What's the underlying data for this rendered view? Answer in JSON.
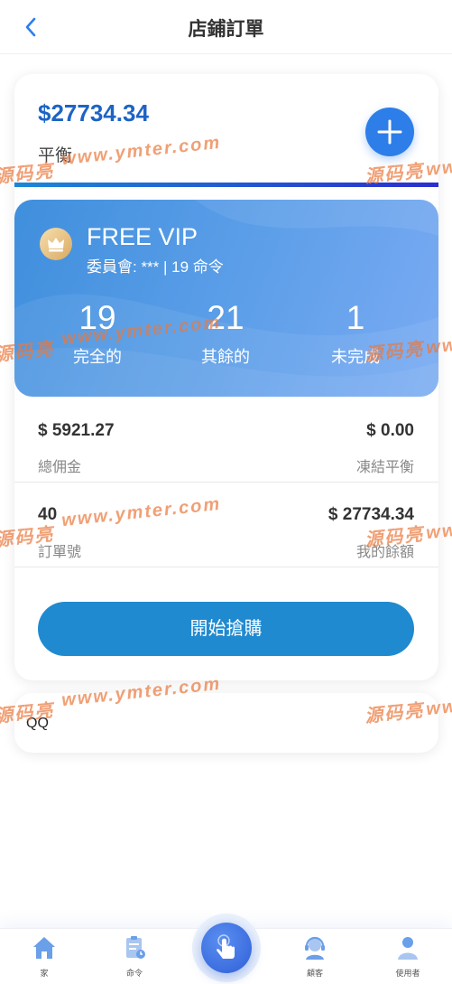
{
  "header": {
    "title": "店鋪訂單"
  },
  "balance": {
    "amount": "$27734.34",
    "label": "平衡"
  },
  "vip": {
    "title": "FREE VIP",
    "subtitle": "委員會: *** | 19 命令",
    "stats": [
      {
        "value": "19",
        "label": "完全的"
      },
      {
        "value": "21",
        "label": "其餘的"
      },
      {
        "value": "1",
        "label": "未完成"
      }
    ]
  },
  "info": {
    "commission_value": "$ 5921.27",
    "commission_label": "總佣金",
    "frozen_value": "$ 0.00",
    "frozen_label": "凍結平衡",
    "orders_value": "40",
    "orders_label": "訂單號",
    "remaining_value": "$ 27734.34",
    "remaining_label": "我的餘額"
  },
  "start_button": "開始搶購",
  "qq": {
    "label": "QQ"
  },
  "watermark": {
    "logo": "源码亮",
    "url": "www.ymter.com"
  },
  "tabs": [
    {
      "label": "家",
      "icon": "home-icon"
    },
    {
      "label": "命令",
      "icon": "order-icon"
    },
    {
      "label": "",
      "icon": "tap-hand-icon"
    },
    {
      "label": "顧客",
      "icon": "customer-service-icon"
    },
    {
      "label": "使用者",
      "icon": "user-icon"
    }
  ],
  "colors": {
    "primary": "#208ad0",
    "balance_text": "#1d64c4",
    "vip_start": "#3f8fdd",
    "vip_end": "#7aabf3",
    "tab_icon": "#6a9fe9"
  }
}
